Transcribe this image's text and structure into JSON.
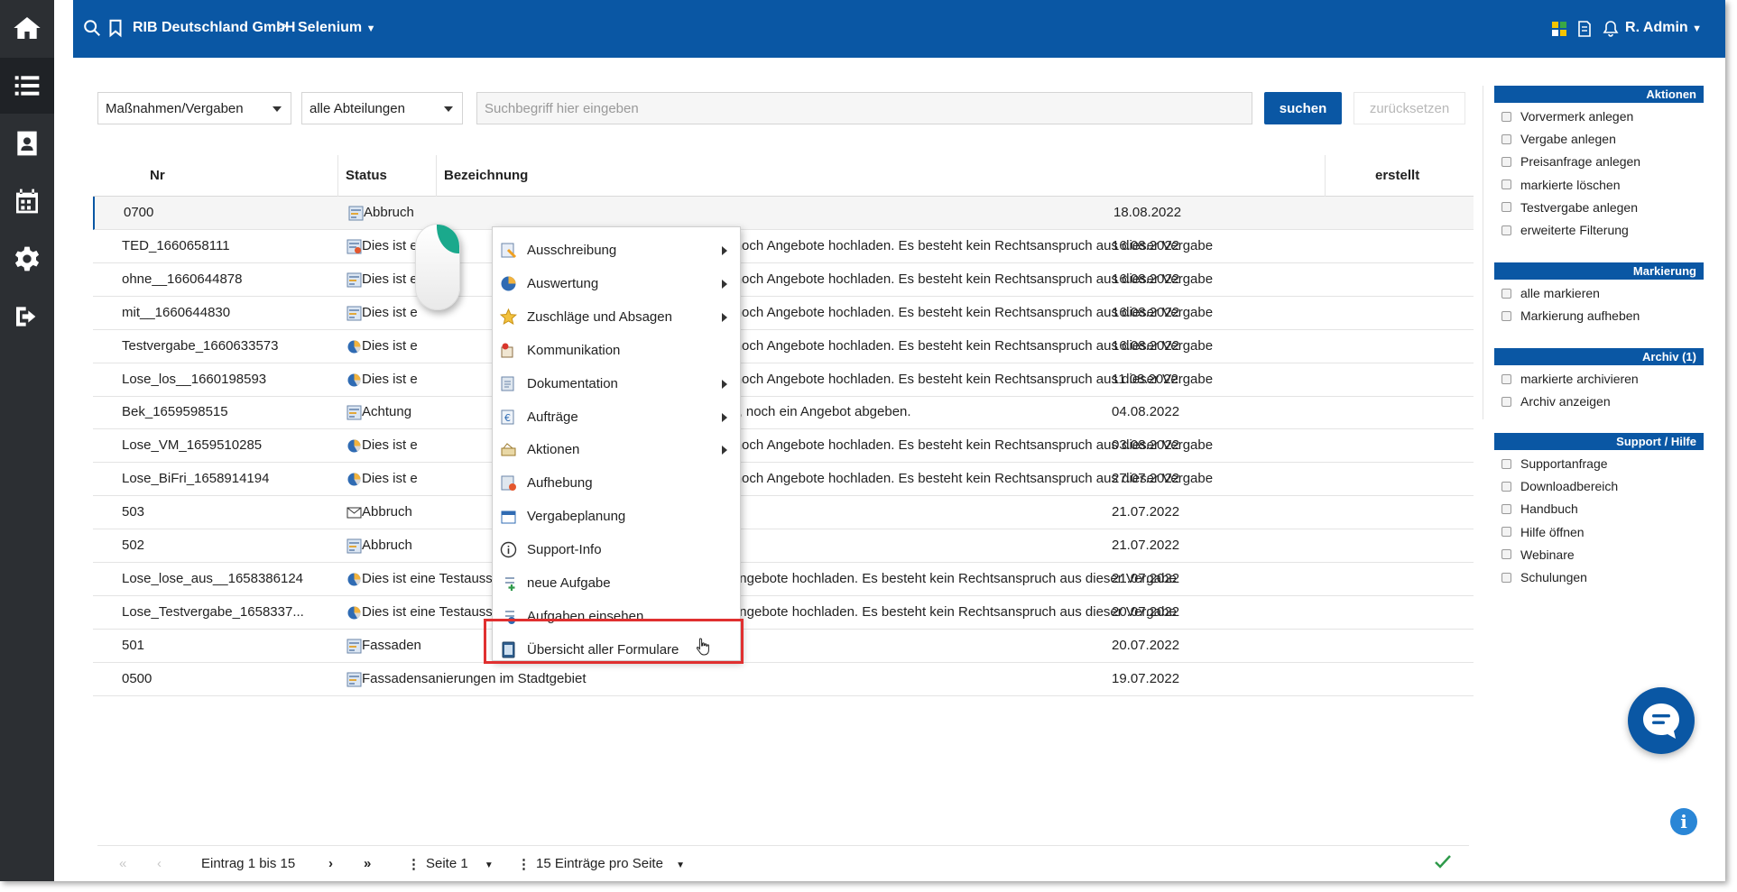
{
  "topbar": {
    "company": "RIB Deutschland GmbH",
    "separator": ">",
    "project": "Selenium",
    "user": "R. Admin"
  },
  "filters": {
    "type_select": "Maßnahmen/Vergaben",
    "department_select": "alle Abteilungen",
    "search_placeholder": "Suchbegriff hier eingeben",
    "search_button": "suchen",
    "reset_button": "zurücksetzen"
  },
  "table": {
    "headers": {
      "nr": "Nr",
      "status": "Status",
      "bezeichnung": "Bezeichnung",
      "erstellt": "erstellt"
    },
    "rows": [
      {
        "nr": "0700",
        "status": "form-icon",
        "bezeichnung": "Abbruch",
        "erstellt": "18.08.2022"
      },
      {
        "nr": "TED_1660658111",
        "status": "form-warning-icon",
        "bezeichnung": "Dies ist e",
        "bezeichnung_tail": "erben, noch Angebote hochladen. Es besteht kein Rechtsanspruch aus dieser Vergabe",
        "erstellt": "16.08.2022"
      },
      {
        "nr": "ohne__1660644878",
        "status": "form-icon",
        "bezeichnung": "Dies ist e",
        "bezeichnung_tail": "erben, noch Angebote hochladen. Es besteht kein Rechtsanspruch aus dieser Vergabe",
        "erstellt": "16.08.2022"
      },
      {
        "nr": "mit__1660644830",
        "status": "form-icon",
        "bezeichnung": "Dies ist e",
        "bezeichnung_tail": "erben, noch Angebote hochladen. Es besteht kein Rechtsanspruch aus dieser Vergabe",
        "erstellt": "16.08.2022"
      },
      {
        "nr": "Testvergabe_1660633573",
        "status": "pie-icon",
        "bezeichnung": "Dies ist e",
        "bezeichnung_tail": "erben, noch Angebote hochladen. Es besteht kein Rechtsanspruch aus dieser Vergabe",
        "erstellt": "16.08.2022"
      },
      {
        "nr": "Lose_los__1660198593",
        "status": "pie-icon",
        "bezeichnung": "Dies ist e",
        "bezeichnung_tail": "erben, noch Angebote hochladen. Es besteht kein Rechtsanspruch aus dieser Vergabe",
        "erstellt": "11.08.2022"
      },
      {
        "nr": "Bek_1659598515",
        "status": "form-icon",
        "bezeichnung": "Achtung",
        "bezeichnung_tail": "ewerben, noch ein Angebot abgeben.",
        "erstellt": "04.08.2022"
      },
      {
        "nr": "Lose_VM_1659510285",
        "status": "pie-icon",
        "bezeichnung": "Dies ist e",
        "bezeichnung_tail": "erben, noch Angebote hochladen. Es besteht kein Rechtsanspruch aus dieser Vergabe",
        "erstellt": "03.08.2022"
      },
      {
        "nr": "Lose_BiFri_1658914194",
        "status": "pie-icon",
        "bezeichnung": "Dies ist e",
        "bezeichnung_tail": "erben, noch Angebote hochladen. Es besteht kein Rechtsanspruch aus dieser Vergabe",
        "erstellt": "27.07.2022"
      },
      {
        "nr": "503",
        "status": "mail-icon",
        "bezeichnung": "Abbruch",
        "erstellt": "21.07.2022"
      },
      {
        "nr": "502",
        "status": "form-icon",
        "bezeichnung": "Abbruch",
        "erstellt": "21.07.2022"
      },
      {
        "nr": "Lose_lose_aus__1658386124",
        "status": "pie-icon",
        "bezeichnung": "Dies ist eine Testausschreibung. Bitte weder bewerben, noch Angebote hochladen. Es besteht kein Rechtsanspruch aus dieser Vergabe",
        "erstellt": "21.07.2022"
      },
      {
        "nr": "Lose_Testvergabe_1658337...",
        "status": "pie-icon",
        "bezeichnung": "Dies ist eine Testausschreibung. Bitte weder bewerben, noch Angebote hochladen. Es besteht kein Rechtsanspruch aus dieser Vergabe",
        "erstellt": "20.07.2022"
      },
      {
        "nr": "501",
        "status": "form-icon",
        "bezeichnung": "Fassaden",
        "erstellt": "20.07.2022"
      },
      {
        "nr": "0500",
        "status": "form-icon",
        "bezeichnung": "Fassadensanierungen im Stadtgebiet",
        "erstellt": "19.07.2022"
      }
    ]
  },
  "pager": {
    "entries": "Eintrag 1 bis 15",
    "page": "Seite 1",
    "per_page": "15 Einträge pro Seite"
  },
  "context_menu": {
    "items": [
      {
        "label": "Ausschreibung",
        "icon": "tender-icon",
        "submenu": true
      },
      {
        "label": "Auswertung",
        "icon": "pie-chart-icon",
        "submenu": true
      },
      {
        "label": "Zuschläge und Absagen",
        "icon": "star-icon",
        "submenu": true
      },
      {
        "label": "Kommunikation",
        "icon": "communication-icon",
        "submenu": false
      },
      {
        "label": "Dokumentation",
        "icon": "documentation-icon",
        "submenu": true
      },
      {
        "label": "Aufträge",
        "icon": "euro-document-icon",
        "submenu": true
      },
      {
        "label": "Aktionen",
        "icon": "actions-icon",
        "submenu": true
      },
      {
        "label": "Aufhebung",
        "icon": "cancel-document-icon",
        "submenu": false
      },
      {
        "label": "Vergabeplanung",
        "icon": "calendar-icon",
        "submenu": false
      },
      {
        "label": "Support-Info",
        "icon": "info-icon",
        "submenu": false
      },
      {
        "label": "neue Aufgabe",
        "icon": "new-task-icon",
        "submenu": false
      },
      {
        "label": "Aufgaben einsehen",
        "icon": "view-tasks-icon",
        "submenu": false
      },
      {
        "label": "Übersicht aller Formulare",
        "icon": "forms-icon",
        "submenu": false
      }
    ]
  },
  "right_panel": {
    "sections": [
      {
        "title": "Aktionen",
        "items": [
          "Vorvermerk anlegen",
          "Vergabe anlegen",
          "Preisanfrage anlegen",
          "markierte löschen",
          "Testvergabe anlegen",
          "erweiterte Filterung"
        ]
      },
      {
        "title": "Markierung",
        "items": [
          "alle markieren",
          "Markierung aufheben"
        ]
      },
      {
        "title": "Archiv (1)",
        "items": [
          "markierte archivieren",
          "Archiv anzeigen"
        ]
      },
      {
        "title": "Support / Hilfe",
        "items": [
          "Supportanfrage",
          "Downloadbereich",
          "Handbuch",
          "Hilfe öffnen",
          "Webinare",
          "Schulungen"
        ]
      }
    ]
  },
  "colors": {
    "primary": "#0a57a4",
    "sidebar": "#2c2f33",
    "highlight": "#e03030",
    "mouse_accent": "#1aa98c"
  }
}
